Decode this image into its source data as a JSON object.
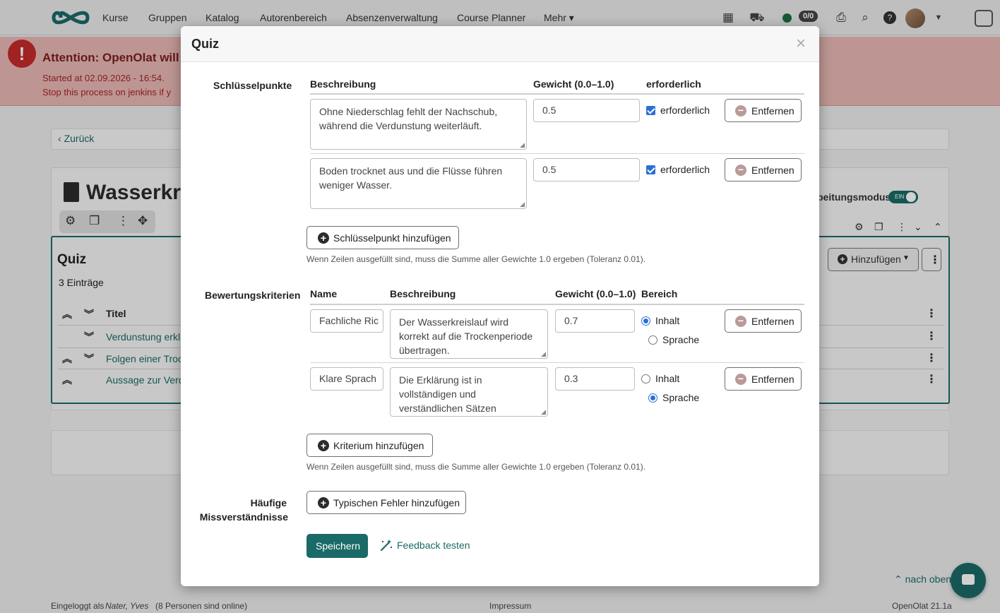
{
  "nav": {
    "items": [
      "Kurse",
      "Gruppen",
      "Katalog",
      "Autorenbereich",
      "Absenzenverwaltung",
      "Course Planner",
      "Mehr ▾"
    ],
    "counter": "0/0"
  },
  "alert": {
    "title": "Attention: OpenOlat will s",
    "line1": "Started at 02.09.2026 - 16:54.",
    "line2": "Stop this process on jenkins if y"
  },
  "back_label": "Zurück",
  "page": {
    "title": "Wasserkre",
    "edit_mode_label": "beitungsmodus",
    "edit_toggle": "EIN",
    "quiz_title": "Quiz",
    "entries": "3 Einträge",
    "add_label": "Hinzufügen",
    "table_header": "Titel",
    "rows": [
      "Verdunstung erkl",
      "Folgen einer Troc",
      "Aussage zur Verd"
    ]
  },
  "footer": {
    "logged_in": "Eingeloggt als",
    "user": "Nater, Yves",
    "online": "(8 Personen sind online)",
    "impressum": "Impressum",
    "version": "OpenOlat 21.1a",
    "to_top": "nach oben"
  },
  "modal": {
    "title": "Quiz",
    "close": "×",
    "key_points": {
      "label": "Schlüsselpunkte",
      "col_desc": "Beschreibung",
      "col_weight": "Gewicht (0.0–1.0)",
      "col_required": "erforderlich",
      "rows": [
        {
          "desc": "Ohne Niederschlag fehlt der Nachschub, während die Verdunstung weiterläuft.",
          "weight": "0.5",
          "required_label": "erforderlich",
          "remove": "Entfernen"
        },
        {
          "desc": "Boden trocknet aus und die Flüsse führen weniger Wasser.",
          "weight": "0.5",
          "required_label": "erforderlich",
          "remove": "Entfernen"
        }
      ],
      "add_button": "Schlüsselpunkt hinzufügen",
      "hint": "Wenn Zeilen ausgefüllt sind, muss die Summe aller Gewichte 1.0 ergeben (Toleranz 0.01)."
    },
    "criteria": {
      "label": "Bewertungskriterien",
      "col_name": "Name",
      "col_desc": "Beschreibung",
      "col_weight": "Gewicht (0.0–1.0)",
      "col_range": "Bereich",
      "rows": [
        {
          "name": "Fachliche Ric",
          "desc": "Der Wasserkreislauf wird korrekt auf die Trockenperiode übertragen.",
          "weight": "0.7",
          "opt1": "Inhalt",
          "opt2": "Sprache",
          "remove": "Entfernen"
        },
        {
          "name": "Klare Sprach",
          "desc": "Die Erklärung ist in vollständigen und verständlichen Sätzen",
          "weight": "0.3",
          "opt1": "Inhalt",
          "opt2": "Sprache",
          "remove": "Entfernen"
        }
      ],
      "add_button": "Kriterium hinzufügen",
      "hint": "Wenn Zeilen ausgefüllt sind, muss die Summe aller Gewichte 1.0 ergeben (Toleranz 0.01)."
    },
    "misconceptions": {
      "label_line1": "Häufige",
      "label_line2": "Missverständnisse",
      "add_button": "Typischen Fehler hinzufügen"
    },
    "save_button": "Speichern",
    "feedback_link": "Feedback testen"
  },
  "colors": {
    "brand": "#1a6a67",
    "checkbox": "#2b6fd6",
    "alert_bg": "#e7b8b4",
    "alert_icon": "#c52a2a"
  }
}
